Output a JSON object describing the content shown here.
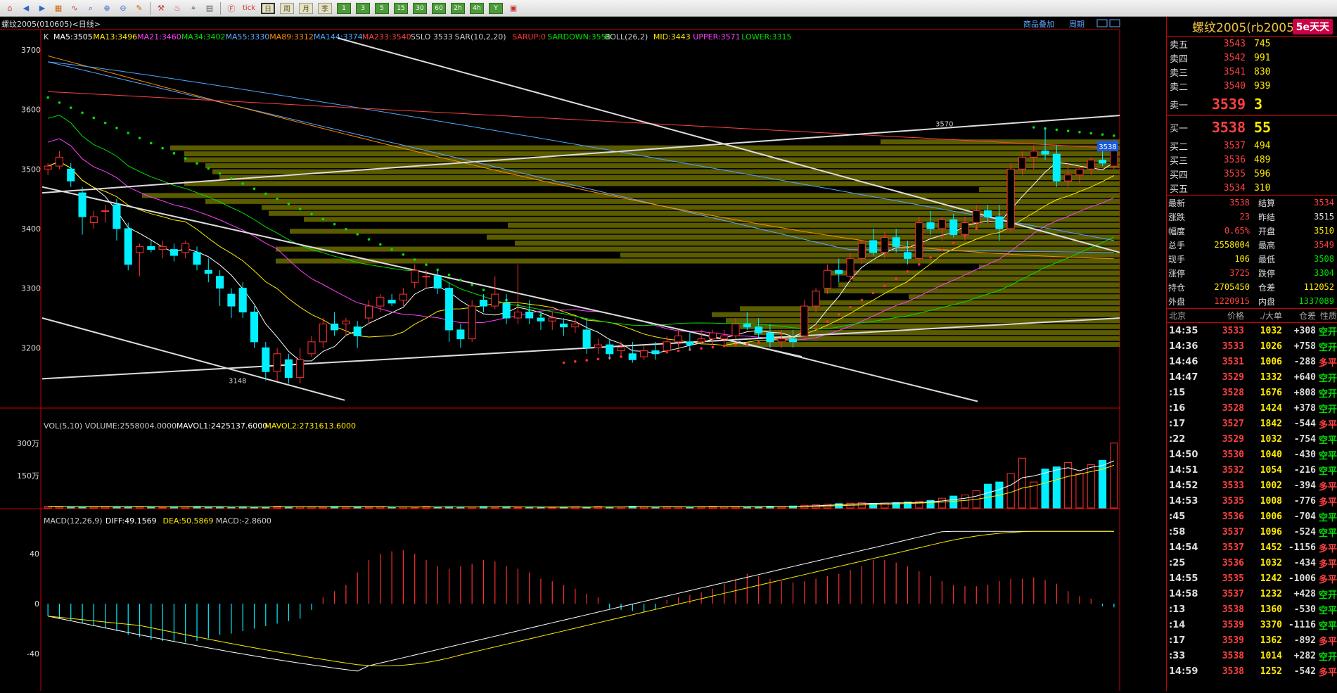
{
  "toolbar": {
    "items": [
      "home-icon",
      "back-icon",
      "forward-icon",
      "quote-icon",
      "chart-icon",
      "search-icon",
      "zoom-in-icon",
      "zoom-out-icon",
      "draw-icon",
      "tool-icon",
      "indicator-icon",
      "tick-icon",
      "grid-icon",
      "f10-icon",
      "tick-label",
      "day-label",
      "week-label",
      "month-label",
      "quarter-label",
      "1",
      "3",
      "5",
      "15",
      "30",
      "60",
      "2h",
      "4h",
      "Y",
      "calc-icon"
    ],
    "tick_label": "tick",
    "day": "日",
    "week": "周",
    "month": "月",
    "quarter": "季",
    "periods": [
      "1",
      "3",
      "5",
      "15",
      "30",
      "60",
      "2h",
      "4h",
      "Y"
    ]
  },
  "header": {
    "symbol": "螺纹2005(010605)<日线>",
    "links": [
      "商品叠加",
      "周期"
    ]
  },
  "ma_legend": {
    "k": "K",
    "items": [
      {
        "t": "MA5:3505",
        "c": "#ffffff"
      },
      {
        "t": "MA13:3496",
        "c": "#ffea00"
      },
      {
        "t": "MA21:3460",
        "c": "#ff40ff"
      },
      {
        "t": "MA34:3402",
        "c": "#00e000"
      },
      {
        "t": "MA55:3330",
        "c": "#5fa8ff"
      },
      {
        "t": "MA89:3312",
        "c": "#ff8c00"
      },
      {
        "t": "MA144:3374",
        "c": "#4aa8ff"
      },
      {
        "t": "MA233:3540",
        "c": "#ff4040"
      },
      {
        "t": "SSLO 3533",
        "c": "#cccccc"
      },
      {
        "t": "SAR(10,2,20)",
        "c": "#cccccc"
      },
      {
        "t": "SARUP:0",
        "c": "#ff3030"
      },
      {
        "t": "SARDOWN:3558",
        "c": "#00e000"
      },
      {
        "t": "BOLL(26,2)",
        "c": "#cccccc"
      },
      {
        "t": "MID:3443",
        "c": "#ffea00"
      },
      {
        "t": "UPPER:3571",
        "c": "#ff40ff"
      },
      {
        "t": "LOWER:3315",
        "c": "#00e000"
      }
    ]
  },
  "price_axis": {
    "ticks": [
      "3700",
      "3600",
      "3500",
      "3400",
      "3300",
      "3200"
    ],
    "marker": "3538",
    "high_label": "3570",
    "low_label": "3148"
  },
  "vol_legend": {
    "items": [
      {
        "t": "VOL(5,10) VOLUME:2558004.0000",
        "c": "#cccccc"
      },
      {
        "t": "MAVOL1:2425137.6000",
        "c": "#ffffff"
      },
      {
        "t": "MAVOL2:2731613.6000",
        "c": "#ffea00"
      }
    ],
    "ticks": [
      "300万",
      "150万"
    ]
  },
  "macd_legend": {
    "items": [
      {
        "t": "MACD(12,26,9)",
        "c": "#cccccc"
      },
      {
        "t": "DIFF:49.1569",
        "c": "#ffffff"
      },
      {
        "t": "DEA:50.5869",
        "c": "#ffea00"
      },
      {
        "t": "MACD:-2.8600",
        "c": "#cccccc"
      }
    ],
    "ticks": [
      "40",
      "0",
      "-40"
    ]
  },
  "chart_data": {
    "type": "candlestick",
    "candles": [
      [
        3500,
        3510,
        3490,
        3505
      ],
      [
        3505,
        3530,
        3500,
        3520
      ],
      [
        3500,
        3510,
        3470,
        3480
      ],
      [
        3460,
        3470,
        3390,
        3420
      ],
      [
        3410,
        3430,
        3400,
        3420
      ],
      [
        3430,
        3440,
        3410,
        3430
      ],
      [
        3440,
        3450,
        3380,
        3400
      ],
      [
        3400,
        3410,
        3330,
        3340
      ],
      [
        3360,
        3375,
        3320,
        3370
      ],
      [
        3370,
        3380,
        3360,
        3365
      ],
      [
        3365,
        3380,
        3350,
        3370
      ],
      [
        3365,
        3375,
        3345,
        3355
      ],
      [
        3360,
        3380,
        3350,
        3375
      ],
      [
        3360,
        3370,
        3330,
        3340
      ],
      [
        3330,
        3350,
        3310,
        3325
      ],
      [
        3320,
        3330,
        3270,
        3300
      ],
      [
        3290,
        3300,
        3250,
        3270
      ],
      [
        3300,
        3310,
        3250,
        3260
      ],
      [
        3260,
        3270,
        3200,
        3210
      ],
      [
        3200,
        3210,
        3145,
        3160
      ],
      [
        3160,
        3200,
        3145,
        3190
      ],
      [
        3180,
        3190,
        3140,
        3150
      ],
      [
        3150,
        3200,
        3140,
        3180
      ],
      [
        3190,
        3220,
        3185,
        3210
      ],
      [
        3210,
        3250,
        3200,
        3240
      ],
      [
        3240,
        3260,
        3220,
        3230
      ],
      [
        3240,
        3250,
        3220,
        3245
      ],
      [
        3235,
        3245,
        3200,
        3220
      ],
      [
        3250,
        3280,
        3240,
        3270
      ],
      [
        3270,
        3290,
        3260,
        3285
      ],
      [
        3280,
        3290,
        3270,
        3275
      ],
      [
        3280,
        3300,
        3270,
        3290
      ],
      [
        3310,
        3340,
        3300,
        3330
      ],
      [
        3320,
        3330,
        3300,
        3320
      ],
      [
        3320,
        3330,
        3290,
        3300
      ],
      [
        3300,
        3310,
        3210,
        3230
      ],
      [
        3230,
        3240,
        3200,
        3215
      ],
      [
        3215,
        3280,
        3210,
        3270
      ],
      [
        3280,
        3290,
        3260,
        3270
      ],
      [
        3270,
        3320,
        3265,
        3290
      ],
      [
        3275,
        3290,
        3240,
        3250
      ],
      [
        3250,
        3340,
        3240,
        3260
      ],
      [
        3260,
        3280,
        3240,
        3250
      ],
      [
        3250,
        3260,
        3230,
        3245
      ],
      [
        3245,
        3260,
        3230,
        3250
      ],
      [
        3240,
        3250,
        3220,
        3235
      ],
      [
        3235,
        3250,
        3225,
        3240
      ],
      [
        3230,
        3250,
        3190,
        3200
      ],
      [
        3200,
        3215,
        3190,
        3205
      ],
      [
        3205,
        3215,
        3180,
        3190
      ],
      [
        3195,
        3210,
        3185,
        3200
      ],
      [
        3190,
        3210,
        3175,
        3180
      ],
      [
        3185,
        3205,
        3180,
        3195
      ],
      [
        3195,
        3210,
        3180,
        3190
      ],
      [
        3195,
        3220,
        3190,
        3210
      ],
      [
        3210,
        3230,
        3200,
        3220
      ],
      [
        3210,
        3225,
        3195,
        3205
      ],
      [
        3210,
        3230,
        3205,
        3215
      ],
      [
        3215,
        3230,
        3205,
        3225
      ],
      [
        3215,
        3230,
        3205,
        3220
      ],
      [
        3220,
        3250,
        3215,
        3240
      ],
      [
        3240,
        3260,
        3230,
        3235
      ],
      [
        3235,
        3250,
        3215,
        3225
      ],
      [
        3225,
        3240,
        3200,
        3210
      ],
      [
        3210,
        3230,
        3200,
        3215
      ],
      [
        3215,
        3230,
        3200,
        3210
      ],
      [
        3220,
        3280,
        3215,
        3270
      ],
      [
        3270,
        3300,
        3260,
        3295
      ],
      [
        3300,
        3340,
        3290,
        3330
      ],
      [
        3330,
        3350,
        3310,
        3325
      ],
      [
        3320,
        3360,
        3310,
        3350
      ],
      [
        3350,
        3380,
        3340,
        3375
      ],
      [
        3380,
        3400,
        3355,
        3360
      ],
      [
        3360,
        3395,
        3350,
        3385
      ],
      [
        3385,
        3400,
        3360,
        3370
      ],
      [
        3360,
        3380,
        3340,
        3350
      ],
      [
        3350,
        3420,
        3345,
        3410
      ],
      [
        3410,
        3430,
        3390,
        3400
      ],
      [
        3400,
        3420,
        3380,
        3415
      ],
      [
        3415,
        3425,
        3385,
        3390
      ],
      [
        3390,
        3420,
        3380,
        3410
      ],
      [
        3410,
        3440,
        3400,
        3430
      ],
      [
        3430,
        3440,
        3410,
        3420
      ],
      [
        3420,
        3440,
        3380,
        3400
      ],
      [
        3400,
        3510,
        3395,
        3500
      ],
      [
        3500,
        3530,
        3490,
        3520
      ],
      [
        3520,
        3540,
        3500,
        3530
      ],
      [
        3530,
        3570,
        3515,
        3525
      ],
      [
        3525,
        3540,
        3470,
        3480
      ],
      [
        3480,
        3510,
        3470,
        3490
      ],
      [
        3490,
        3505,
        3475,
        3500
      ],
      [
        3500,
        3520,
        3490,
        3515
      ],
      [
        3515,
        3540,
        3505,
        3510
      ],
      [
        3505,
        3549,
        3500,
        3538
      ]
    ],
    "volume_wan": [
      8,
      6,
      4,
      5,
      6,
      7,
      6,
      5,
      7,
      4,
      3,
      6,
      5,
      7,
      4,
      5,
      3,
      6,
      4,
      5,
      8,
      4,
      5,
      6,
      4,
      7,
      5,
      6,
      4,
      6,
      3,
      5,
      4,
      7,
      3,
      6,
      4,
      5,
      7,
      4,
      6,
      3,
      5,
      4,
      3,
      5,
      6,
      3,
      7,
      4,
      5,
      8,
      5,
      4,
      6,
      5,
      4,
      6,
      8,
      5,
      7,
      4,
      5,
      8,
      6,
      9,
      12,
      15,
      18,
      20,
      22,
      25,
      20,
      23,
      25,
      28,
      30,
      35,
      45,
      55,
      60,
      80,
      110,
      120,
      160,
      230,
      120,
      180,
      190,
      210,
      160,
      200,
      220,
      300
    ],
    "macd_hist": [
      -10,
      -12,
      -14,
      -16,
      -18,
      -20,
      -22,
      -25,
      -27,
      -29,
      -30,
      -30,
      -31,
      -30,
      -28,
      -25,
      -24,
      -22,
      -20,
      -18,
      -16,
      -14,
      -12,
      -5,
      5,
      10,
      15,
      25,
      35,
      40,
      42,
      43,
      40,
      35,
      30,
      28,
      30,
      32,
      35,
      34,
      30,
      28,
      25,
      20,
      18,
      15,
      12,
      8,
      5,
      -4,
      -5,
      -6,
      -7,
      -5,
      3,
      5,
      7,
      9,
      12,
      16,
      20,
      24,
      22,
      20,
      18,
      17,
      18,
      20,
      22,
      24,
      27,
      30,
      35,
      35,
      33,
      30,
      26,
      22,
      18,
      15,
      14,
      14,
      15,
      18,
      20,
      20,
      21,
      19,
      16,
      10,
      6,
      4,
      -2,
      -3
    ],
    "ylim_price": [
      3100,
      3720
    ],
    "ylim_vol_wan": [
      0,
      400
    ],
    "ylim_macd": [
      -70,
      70
    ]
  },
  "panel": {
    "title": "螺纹2005(rb2005)",
    "logo": "5e天天",
    "asks": [
      {
        "label": "卖五",
        "price": "3543",
        "vol": "745"
      },
      {
        "label": "卖四",
        "price": "3542",
        "vol": "991"
      },
      {
        "label": "卖三",
        "price": "3541",
        "vol": "830"
      },
      {
        "label": "卖二",
        "price": "3540",
        "vol": "939"
      },
      {
        "label": "卖一",
        "price": "3539",
        "vol": "3"
      }
    ],
    "bids": [
      {
        "label": "买一",
        "price": "3538",
        "vol": "55"
      },
      {
        "label": "买二",
        "price": "3537",
        "vol": "494"
      },
      {
        "label": "买三",
        "price": "3536",
        "vol": "489"
      },
      {
        "label": "买四",
        "price": "3535",
        "vol": "596"
      },
      {
        "label": "买五",
        "price": "3534",
        "vol": "310"
      }
    ],
    "quote": [
      {
        "a": "最新",
        "b": "3538",
        "c": "结算",
        "d": "3534"
      },
      {
        "a": "涨跌",
        "b": "23",
        "c": "昨结",
        "d": "3515"
      },
      {
        "a": "幅度",
        "b": "0.65%",
        "c": "开盘",
        "d": "3510"
      },
      {
        "a": "总手",
        "b": "2558004",
        "c": "最高",
        "d": "3549"
      },
      {
        "a": "现手",
        "b": "106",
        "c": "最低",
        "d": "3508"
      },
      {
        "a": "涨停",
        "b": "3725",
        "c": "跌停",
        "d": "3304"
      },
      {
        "a": "持仓",
        "b": "2705450",
        "c": "仓差",
        "d": "112052"
      },
      {
        "a": "外盘",
        "b": "1220915",
        "c": "内盘",
        "d": "1337089"
      }
    ],
    "tick_header": [
      "北京",
      "价格",
      "./大单",
      "仓差",
      "性质"
    ],
    "ticks": [
      {
        "t": "14:35",
        "p": "3533",
        "v": "1032",
        "d": "+308",
        "k": "空开"
      },
      {
        "t": "14:36",
        "p": "3533",
        "v": "1026",
        "d": "+758",
        "k": "空开"
      },
      {
        "t": "14:46",
        "p": "3531",
        "v": "1006",
        "d": "-288",
        "k": "多平"
      },
      {
        "t": "14:47",
        "p": "3529",
        "v": "1332",
        "d": "+640",
        "k": "空开"
      },
      {
        "t": ":15",
        "p": "3528",
        "v": "1676",
        "d": "+808",
        "k": "空开"
      },
      {
        "t": ":16",
        "p": "3528",
        "v": "1424",
        "d": "+378",
        "k": "空开"
      },
      {
        "t": ":17",
        "p": "3527",
        "v": "1842",
        "d": "-544",
        "k": "多平"
      },
      {
        "t": ":22",
        "p": "3529",
        "v": "1032",
        "d": "-754",
        "k": "空平"
      },
      {
        "t": "14:50",
        "p": "3530",
        "v": "1040",
        "d": "-430",
        "k": "空平"
      },
      {
        "t": "14:51",
        "p": "3532",
        "v": "1054",
        "d": "-216",
        "k": "空平"
      },
      {
        "t": "14:52",
        "p": "3533",
        "v": "1002",
        "d": "-394",
        "k": "多平"
      },
      {
        "t": "14:53",
        "p": "3535",
        "v": "1008",
        "d": "-776",
        "k": "多平"
      },
      {
        "t": ":45",
        "p": "3536",
        "v": "1006",
        "d": "-704",
        "k": "空平"
      },
      {
        "t": ":58",
        "p": "3537",
        "v": "1096",
        "d": "-524",
        "k": "空平"
      },
      {
        "t": "14:54",
        "p": "3537",
        "v": "1452",
        "d": "-1156",
        "k": "多平"
      },
      {
        "t": ":25",
        "p": "3536",
        "v": "1032",
        "d": "-434",
        "k": "多平"
      },
      {
        "t": "14:55",
        "p": "3535",
        "v": "1242",
        "d": "-1006",
        "k": "多平"
      },
      {
        "t": "14:58",
        "p": "3537",
        "v": "1232",
        "d": "+428",
        "k": "空开"
      },
      {
        "t": ":13",
        "p": "3538",
        "v": "1360",
        "d": "-530",
        "k": "空平"
      },
      {
        "t": ":14",
        "p": "3539",
        "v": "3370",
        "d": "-1116",
        "k": "空平"
      },
      {
        "t": ":17",
        "p": "3539",
        "v": "1362",
        "d": "-892",
        "k": "多平"
      },
      {
        "t": ":33",
        "p": "3538",
        "v": "1014",
        "d": "+282",
        "k": "空开"
      },
      {
        "t": "14:59",
        "p": "3538",
        "v": "1252",
        "d": "-542",
        "k": "多平"
      }
    ]
  }
}
